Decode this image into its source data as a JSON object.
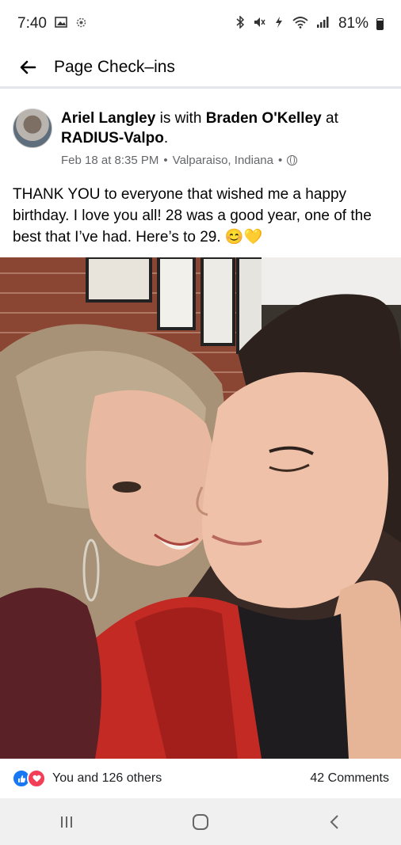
{
  "status_bar": {
    "time": "7:40",
    "battery": "81%",
    "icons": [
      "gallery-icon",
      "settings-icon",
      "bluetooth-icon",
      "mute-icon",
      "data-icon",
      "wifi-icon",
      "signal-icon",
      "battery-icon"
    ]
  },
  "header": {
    "title": "Page Check–ins",
    "back_icon": "arrow-left-icon"
  },
  "post": {
    "author": "Ariel Langley",
    "with_text": " is with ",
    "tagged": "Braden O'Kelley",
    "at_text": " at ",
    "place": "RADIUS-Valpo",
    "end": ".",
    "date": "Feb 18 at 8:35 PM",
    "location": "Valparaiso, Indiana",
    "separator": "•",
    "privacy_icon": "globe-icon",
    "text": "THANK YOU to everyone that wished me a happy birthday. I love you all! 28 was a good year, one of the best that I’ve had. Here’s to 29. 😊💛"
  },
  "reactions": {
    "summary": "You and 126 others",
    "comments": "42 Comments",
    "icons": [
      "like-icon",
      "love-icon"
    ]
  },
  "colors": {
    "accent": "#1877f2",
    "love": "#f33e58",
    "meta_text": "#65676b"
  }
}
